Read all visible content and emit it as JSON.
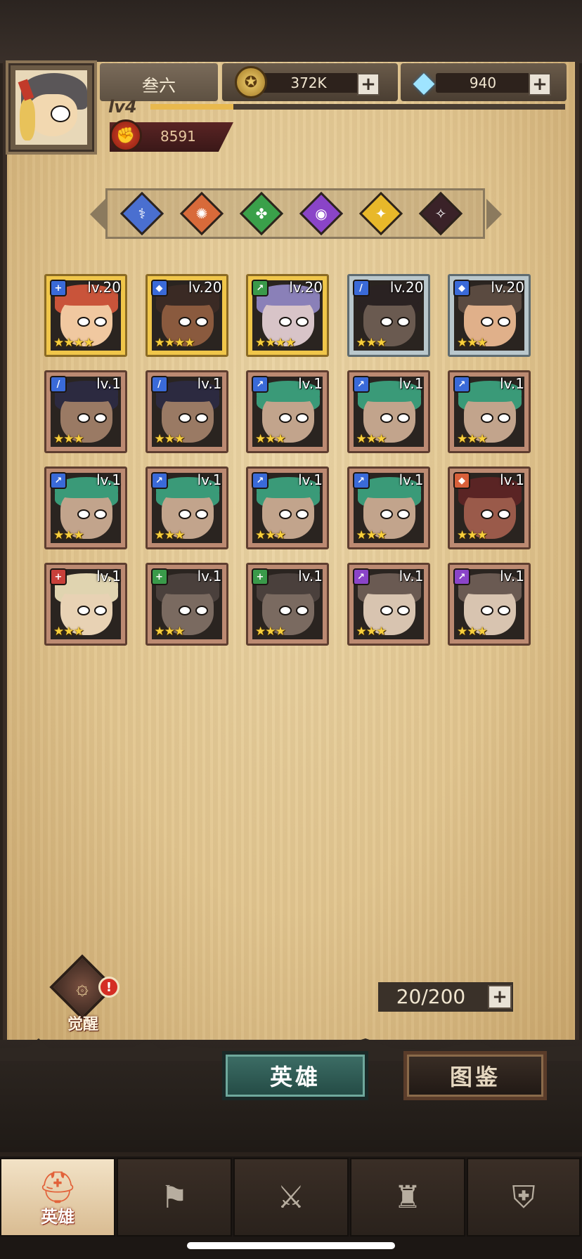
{
  "player": {
    "name": "叁六",
    "level": "lv4",
    "power": "8591",
    "xp_fraction": 0.2
  },
  "resources": {
    "gold": "372K",
    "diamonds": "940",
    "plus": "+"
  },
  "filters": [
    {
      "name": "filter-blue",
      "color": "#4a6fd0",
      "icon": "⚕"
    },
    {
      "name": "filter-orange",
      "color": "#d86a3a",
      "icon": "✺"
    },
    {
      "name": "filter-green",
      "color": "#3aa04a",
      "icon": "✤"
    },
    {
      "name": "filter-purple",
      "color": "#8a44c8",
      "icon": "◉"
    },
    {
      "name": "filter-yellow",
      "color": "#e8b82a",
      "icon": "✦"
    },
    {
      "name": "filter-dark",
      "color": "#3a2228",
      "icon": "✧"
    }
  ],
  "heroes": [
    {
      "level": "lv.20",
      "stars": "★★★★",
      "frame": "gold",
      "class_color": "#3a6ad8",
      "class_icon": "+",
      "hair": "#c9543a",
      "skin": "#f0c8a0"
    },
    {
      "level": "lv.20",
      "stars": "★★★★",
      "frame": "gold",
      "class_color": "#3a6ad8",
      "class_icon": "◆",
      "hair": "#3a2a24",
      "skin": "#8a5a3e"
    },
    {
      "level": "lv.20",
      "stars": "★★★★",
      "frame": "gold",
      "class_color": "#3a9a4a",
      "class_icon": "↗",
      "hair": "#8a80b8",
      "skin": "#d8c4c8"
    },
    {
      "level": "lv.20",
      "stars": "★★★",
      "frame": "silver",
      "class_color": "#3a6ad8",
      "class_icon": "/",
      "hair": "#2a2222",
      "skin": "#6a5a50"
    },
    {
      "level": "lv.20",
      "stars": "★★★",
      "frame": "silver",
      "class_color": "#3a6ad8",
      "class_icon": "◆",
      "hair": "#5a4a40",
      "skin": "#e0b08a"
    },
    {
      "level": "lv.1",
      "stars": "★★★",
      "frame": "bronze",
      "class_color": "#3a6ad8",
      "class_icon": "/",
      "hair": "#2c2a40",
      "skin": "#9a7a64"
    },
    {
      "level": "lv.1",
      "stars": "★★★",
      "frame": "bronze",
      "class_color": "#3a6ad8",
      "class_icon": "/",
      "hair": "#2c2a40",
      "skin": "#9a7a64"
    },
    {
      "level": "lv.1",
      "stars": "★★★",
      "frame": "bronze",
      "class_color": "#3a6ad8",
      "class_icon": "↗",
      "hair": "#3a9a78",
      "skin": "#c2a48c"
    },
    {
      "level": "lv.1",
      "stars": "★★★",
      "frame": "bronze",
      "class_color": "#3a6ad8",
      "class_icon": "↗",
      "hair": "#3a9a78",
      "skin": "#c2a48c"
    },
    {
      "level": "lv.1",
      "stars": "★★★",
      "frame": "bronze",
      "class_color": "#3a6ad8",
      "class_icon": "↗",
      "hair": "#3a9a78",
      "skin": "#c2a48c"
    },
    {
      "level": "lv.1",
      "stars": "★★★",
      "frame": "bronze",
      "class_color": "#3a6ad8",
      "class_icon": "↗",
      "hair": "#3a9a78",
      "skin": "#c2a48c"
    },
    {
      "level": "lv.1",
      "stars": "★★★",
      "frame": "bronze",
      "class_color": "#3a6ad8",
      "class_icon": "↗",
      "hair": "#3a9a78",
      "skin": "#c2a48c"
    },
    {
      "level": "lv.1",
      "stars": "★★★",
      "frame": "bronze",
      "class_color": "#3a6ad8",
      "class_icon": "↗",
      "hair": "#3a9a78",
      "skin": "#c2a48c"
    },
    {
      "level": "lv.1",
      "stars": "★★★",
      "frame": "bronze",
      "class_color": "#3a6ad8",
      "class_icon": "↗",
      "hair": "#3a9a78",
      "skin": "#c2a48c"
    },
    {
      "level": "lv.1",
      "stars": "★★★",
      "frame": "bronze",
      "class_color": "#d8603a",
      "class_icon": "◆",
      "hair": "#5a2424",
      "skin": "#9a5a4a"
    },
    {
      "level": "lv.1",
      "stars": "★★★",
      "frame": "bronze",
      "class_color": "#c8403a",
      "class_icon": "+",
      "hair": "#e0d4b0",
      "skin": "#e8d2b4"
    },
    {
      "level": "lv.1",
      "stars": "★★★",
      "frame": "bronze",
      "class_color": "#3a9a4a",
      "class_icon": "+",
      "hair": "#4a403c",
      "skin": "#7a6a60"
    },
    {
      "level": "lv.1",
      "stars": "★★★",
      "frame": "bronze",
      "class_color": "#3a9a4a",
      "class_icon": "+",
      "hair": "#4a403c",
      "skin": "#7a6a60"
    },
    {
      "level": "lv.1",
      "stars": "★★★",
      "frame": "bronze",
      "class_color": "#8a44c8",
      "class_icon": "↗",
      "hair": "#6a5a52",
      "skin": "#d8c4b0"
    },
    {
      "level": "lv.1",
      "stars": "★★★",
      "frame": "bronze",
      "class_color": "#8a44c8",
      "class_icon": "↗",
      "hair": "#6a5a52",
      "skin": "#d8c4b0"
    }
  ],
  "awaken": {
    "label": "觉醒",
    "alert": "!"
  },
  "capacity": {
    "text": "20/200"
  },
  "tabs": {
    "heroes": "英雄",
    "codex": "图鉴"
  },
  "nav": [
    {
      "name": "nav-heroes",
      "label": "英雄",
      "glyph": "⛑",
      "active": true
    },
    {
      "name": "nav-expedition",
      "label": "",
      "glyph": "⚑",
      "active": false
    },
    {
      "name": "nav-battle",
      "label": "",
      "glyph": "⚔",
      "active": false
    },
    {
      "name": "nav-castle",
      "label": "",
      "glyph": "♜",
      "active": false
    },
    {
      "name": "nav-guild",
      "label": "",
      "glyph": "⛨",
      "active": false
    }
  ]
}
